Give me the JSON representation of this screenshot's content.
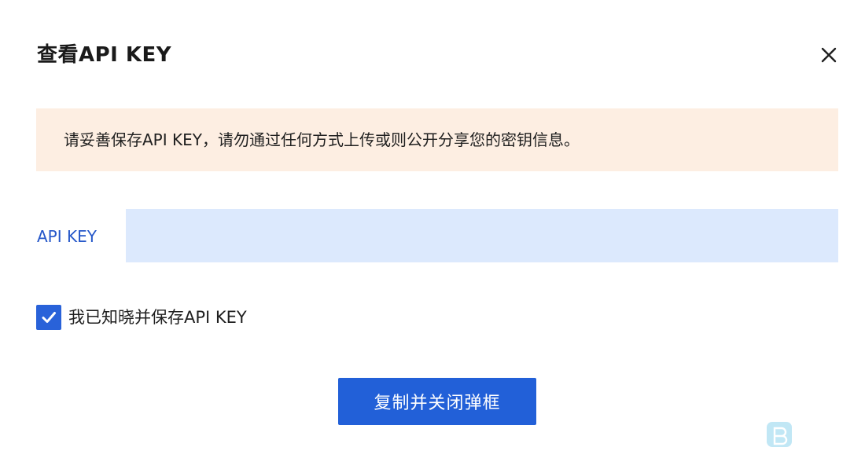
{
  "dialog": {
    "title": "查看API KEY",
    "close_icon": "close-icon"
  },
  "notice": {
    "text": "请妥善保存API KEY，请勿通过任何方式上传或则公开分享您的密钥信息。"
  },
  "api_key": {
    "label": "API KEY",
    "value": ""
  },
  "acknowledge": {
    "label": "我已知晓并保存API KEY",
    "checked": true
  },
  "actions": {
    "primary_label": "复制并关闭弹框"
  },
  "colors": {
    "primary": "#2260d8",
    "notice_bg": "#fdeee2",
    "field_bg": "#dce9fd",
    "label_blue": "#2557c9"
  }
}
